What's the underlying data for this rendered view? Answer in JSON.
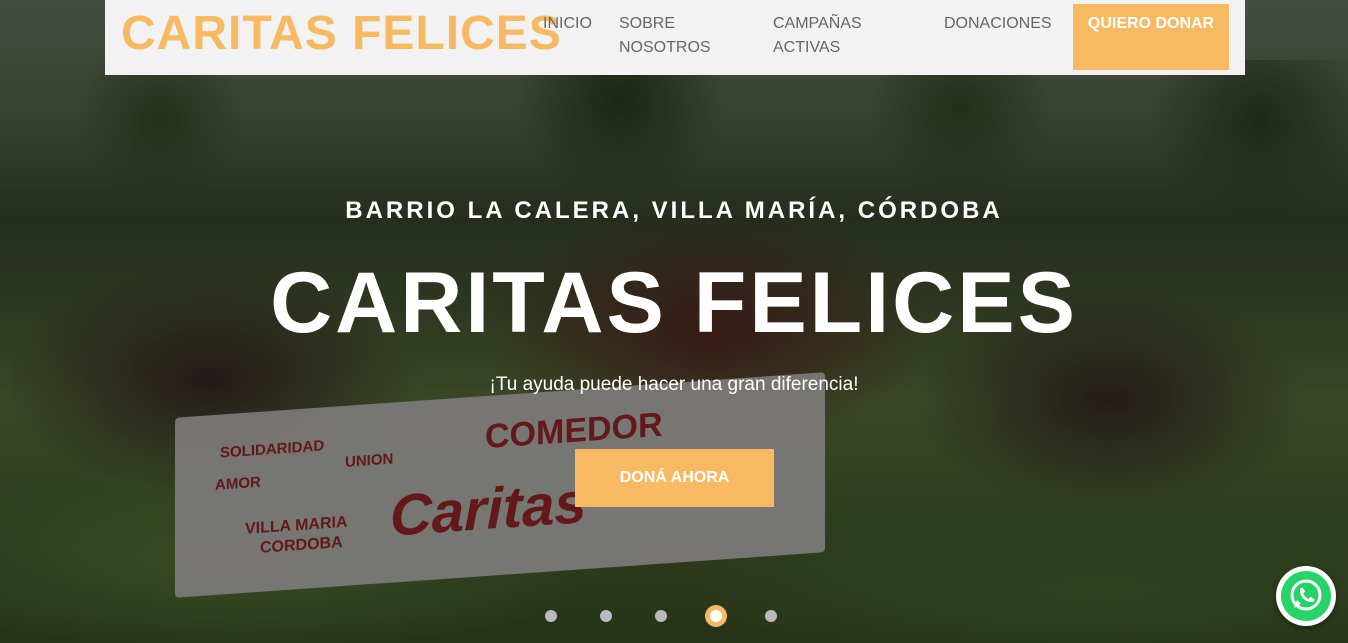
{
  "header": {
    "logo": "CARITAS FELICES",
    "nav": [
      {
        "label": "INICIO"
      },
      {
        "label": "SOBRE NOSOTROS"
      },
      {
        "label": "CAMPAÑAS ACTIVAS"
      },
      {
        "label": "DONACIONES"
      }
    ],
    "cta_label": "QUIERO DONAR"
  },
  "hero": {
    "subtitle": "BARRIO LA CALERA, VILLA MARÍA, CÓRDOBA",
    "title": "CARITAS FELICES",
    "tagline": "¡Tu ayuda puede hacer una gran diferencia!",
    "button_label": "DONÁ AHORA",
    "banner": {
      "line1": "COMEDOR",
      "line2": "Caritas",
      "word1": "SOLIDARIDAD",
      "word2": "AMOR",
      "word3": "UNION",
      "place1": "VILLA MARIA",
      "place2": "CORDOBA"
    }
  },
  "carousel": {
    "slide_count": 5,
    "active_index": 3
  },
  "colors": {
    "accent": "#f8b963",
    "header_bg": "#f2f2f2",
    "nav_text": "#666666",
    "whatsapp": "#25d366"
  },
  "icons": {
    "whatsapp": "whatsapp-icon"
  }
}
